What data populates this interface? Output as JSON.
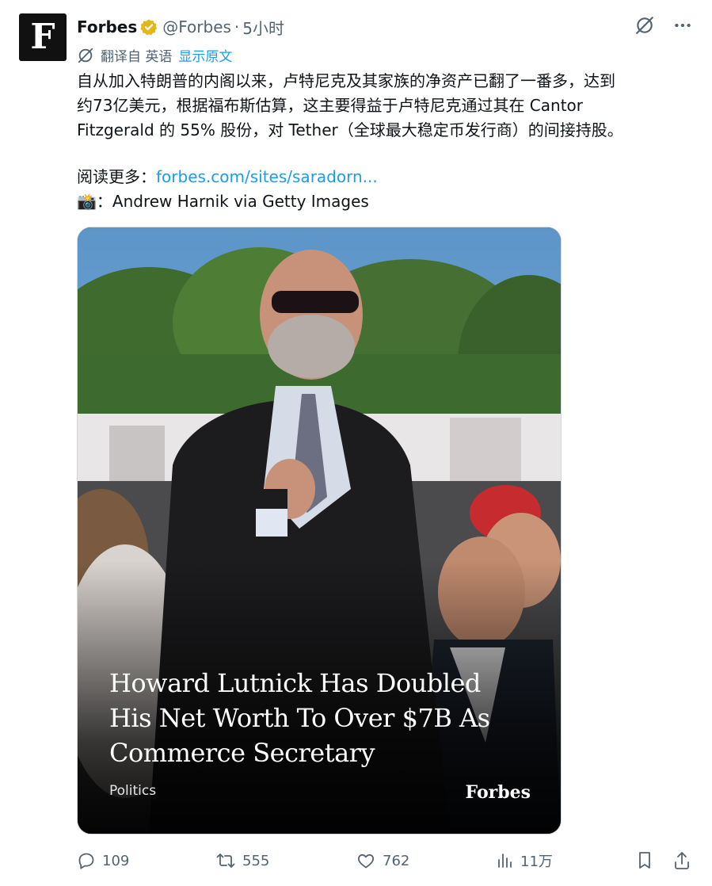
{
  "author": {
    "avatar_letter": "F",
    "name": "Forbes",
    "handle": "@Forbes",
    "separator": "·",
    "time": "5小时"
  },
  "translation": {
    "label": "翻译自 英语",
    "show_original": "显示原文"
  },
  "body": {
    "lines": [
      "自从加入特朗普的内阁以来，卢特尼克及其家族的净资产已翻了一番多，达到",
      "约73亿美元，根据福布斯估算，这主要得益于卢特尼克通过其在 Cantor",
      "Fitzgerald 的 55% 股份，对 Tether（全球最大稳定币发行商）的间接持股。"
    ],
    "read_more_label": "阅读更多：",
    "read_more_link": "forbes.com/sites/saradorn...",
    "photo_credit_emoji": "📸",
    "photo_credit": "：Andrew Harnik via Getty Images"
  },
  "media": {
    "headline_lines": [
      "Howard Lutnick Has Doubled",
      "His Net Worth To Over $7B As",
      "Commerce Secretary"
    ],
    "category": "Politics",
    "brand": "Forbes"
  },
  "actions": {
    "replies": "109",
    "reposts": "555",
    "likes": "762",
    "views": "11万"
  },
  "colors": {
    "link": "#1d9bf0",
    "verified_badge": "#e2b719",
    "muted": "#536471"
  }
}
